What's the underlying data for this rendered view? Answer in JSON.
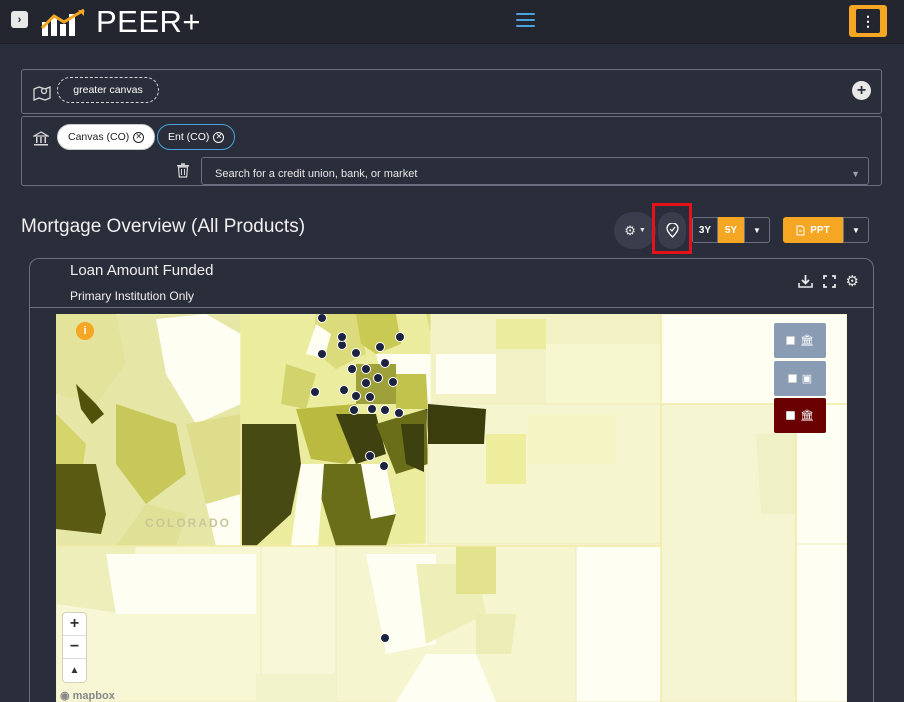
{
  "topbar": {
    "expand_icon": "chevron-right-icon",
    "logo_text": "PEER+",
    "menu_icon": "hamburger-icon",
    "more_icon": "kebab-menu-icon",
    "accent": "#f5a623"
  },
  "filters": {
    "market_icon": "map-pin-icon",
    "market_chip": "greater canvas",
    "add_icon": "plus-icon",
    "institution_icon": "bank-icon",
    "institutions": [
      {
        "label": "Canvas (CO)"
      },
      {
        "label": "Ent (CO)"
      }
    ],
    "remove_icon": "close-circle-icon",
    "trash_icon": "trash-icon",
    "search_placeholder": "Search for a credit union, bank, or market"
  },
  "section": {
    "title": "Mortgage Overview (All Products)",
    "settings_icon": "gear-icon",
    "location_icon": "location-pin-icon",
    "range_options": [
      "3Y",
      "5Y"
    ],
    "range_selected": "5Y",
    "export_label": "PPT"
  },
  "card": {
    "title": "Loan Amount Funded",
    "subtitle": "Primary Institution Only",
    "tools": [
      "download-icon",
      "fullscreen-icon",
      "gear-icon"
    ]
  },
  "map": {
    "info_label": "i",
    "region_label": "COLORADO",
    "attribution": "mapbox",
    "zoom_in": "+",
    "zoom_out": "−",
    "compass": "▲",
    "layers": [
      {
        "icon": "bank-icon",
        "color": "#8a9bb4"
      },
      {
        "icon": "money-icon",
        "color": "#8a9bb4"
      },
      {
        "icon": "bank-icon",
        "color": "#6b0000"
      }
    ]
  }
}
